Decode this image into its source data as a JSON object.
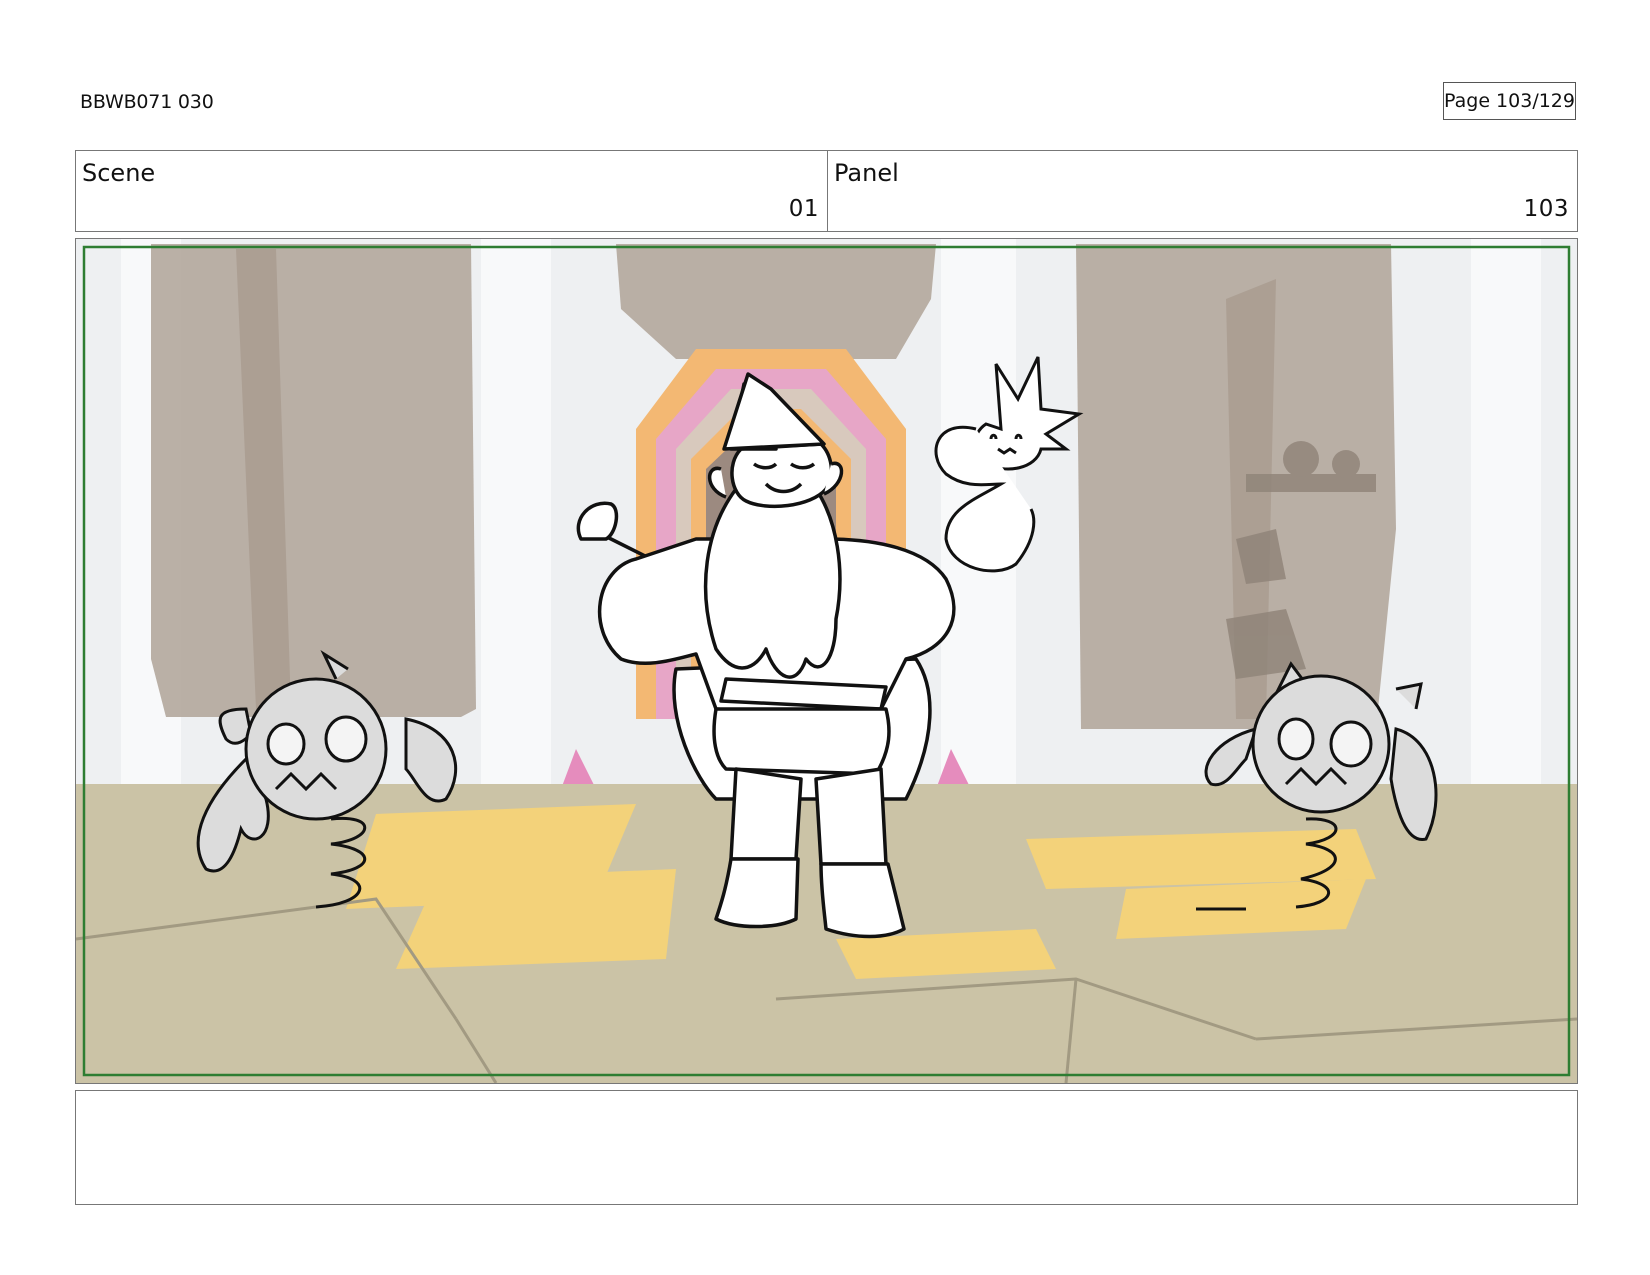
{
  "header": {
    "doc_id": "BBWB071 030",
    "page_label": "Page 103/129"
  },
  "info": {
    "scene_label": "Scene",
    "scene_value": "01",
    "panel_label": "Panel",
    "panel_value": "103"
  },
  "frame": {
    "safe_area_color": "#2e7d32",
    "palette": {
      "sky": "#eef0f2",
      "rock": "#b3a79c",
      "floor": "#cbc3a6",
      "gold": "#f3d27a",
      "pink": "#e7a6c7",
      "orange": "#f3b873",
      "crystal": "#e58cbd",
      "doodad_fill": "#dcdcdc",
      "line": "#111111"
    }
  },
  "notes": {
    "text": ""
  }
}
